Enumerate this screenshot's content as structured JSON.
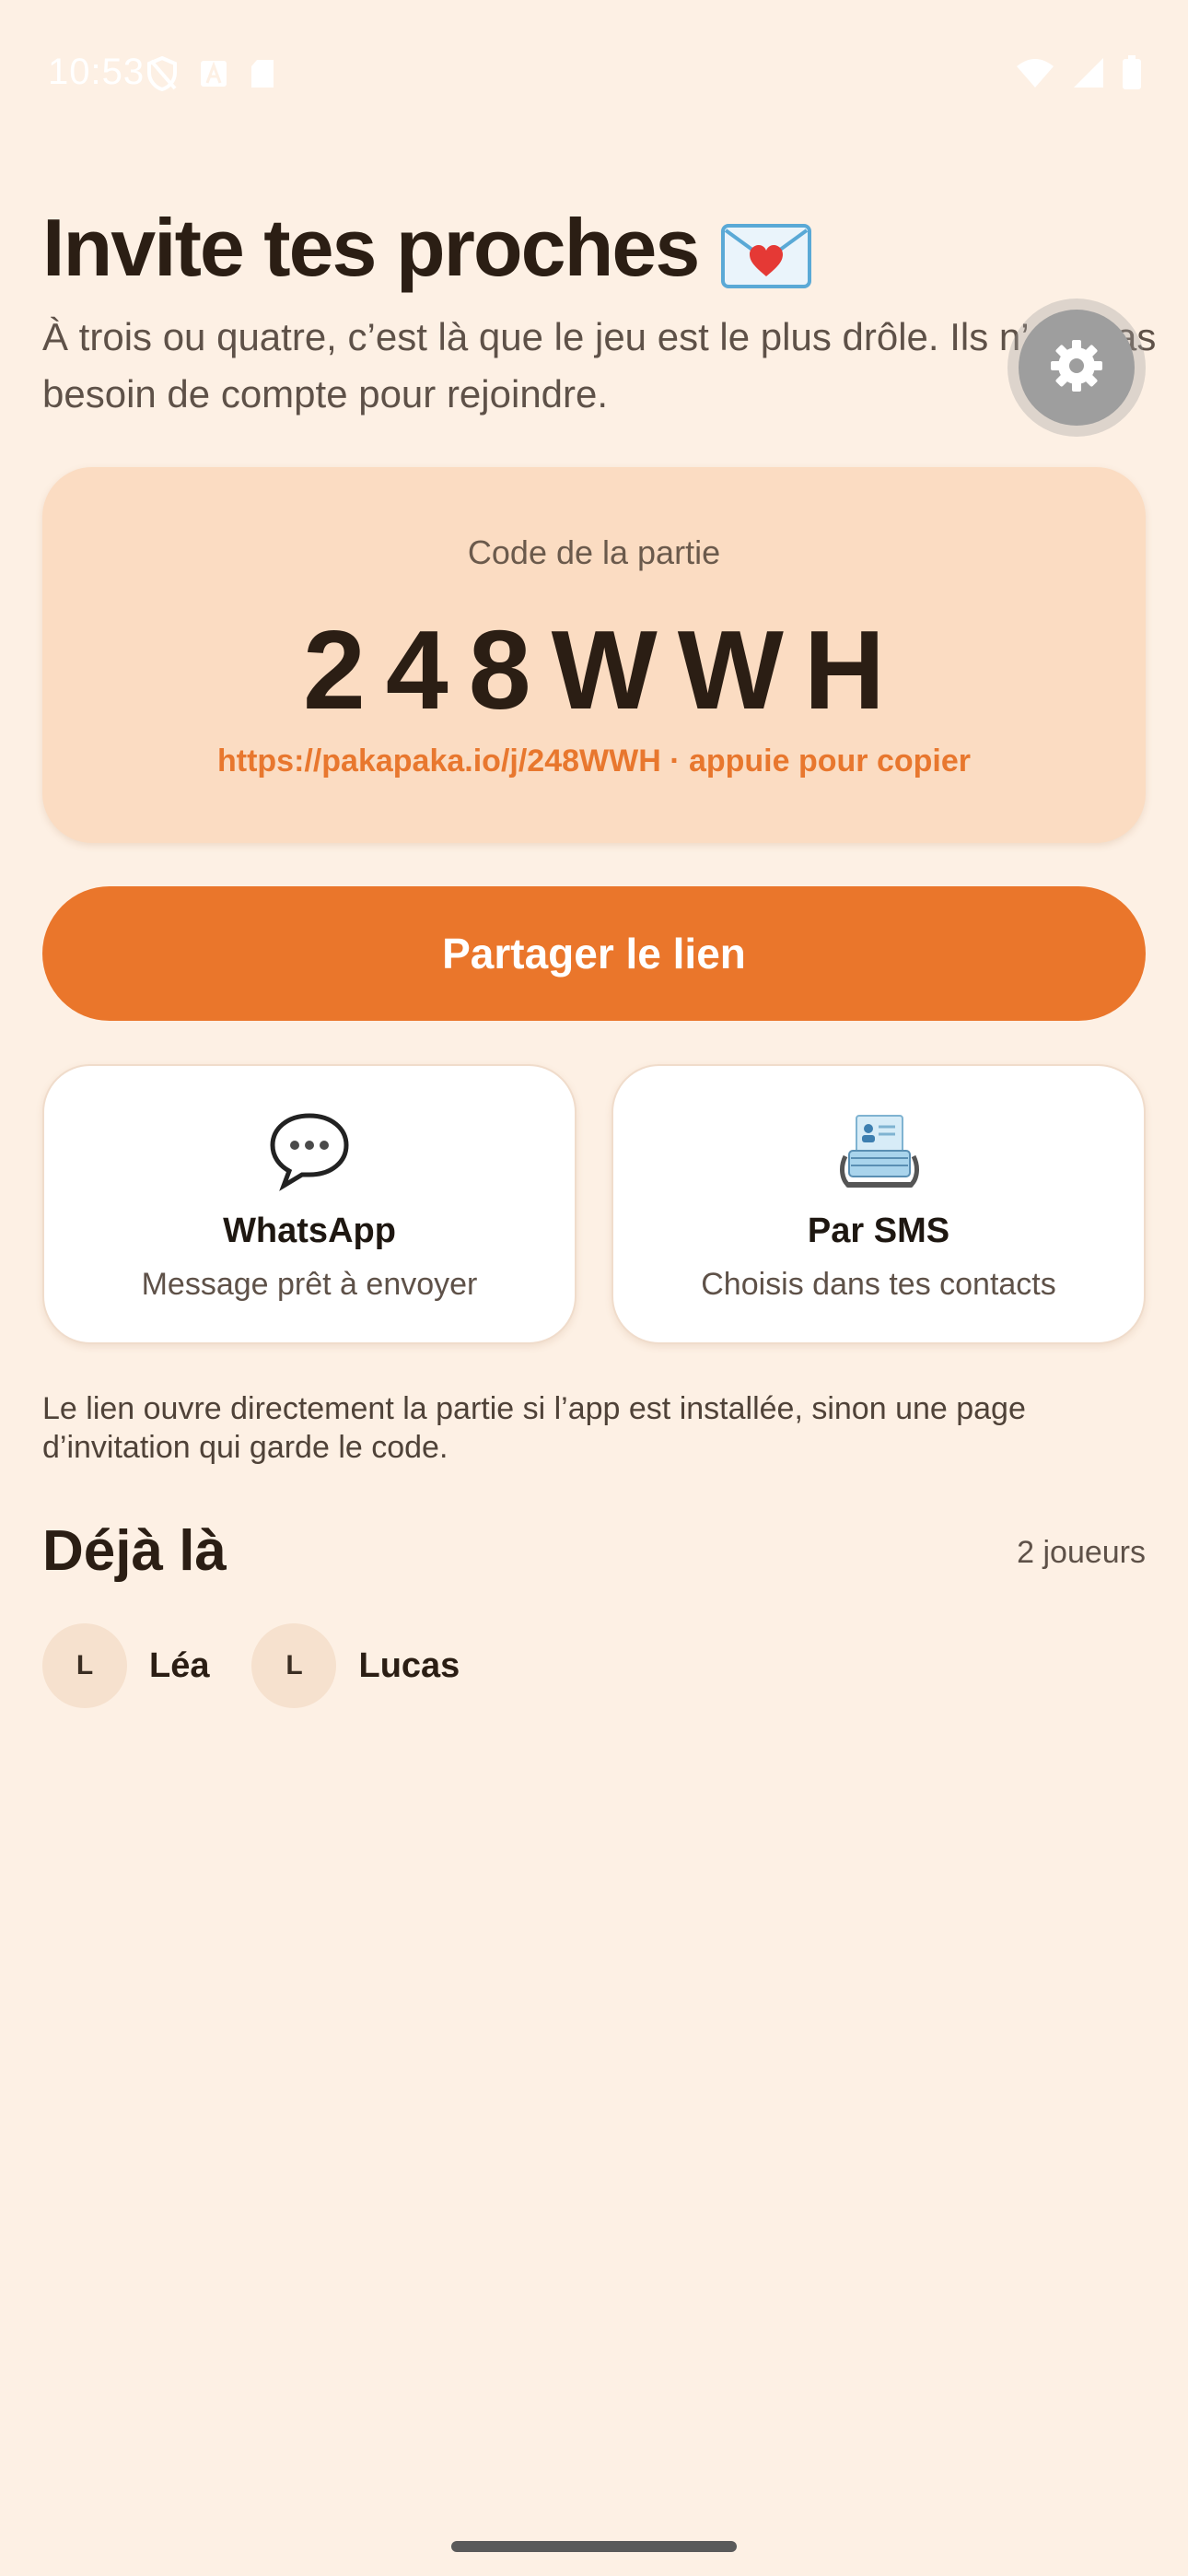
{
  "status_bar": {
    "time": "10:53",
    "icons_left": [
      "shield-off-icon",
      "a-icon",
      "sd-card-icon"
    ],
    "icons_right": [
      "wifi-icon",
      "signal-icon",
      "battery-icon"
    ]
  },
  "header": {
    "title": "Invite tes proches",
    "title_icon": "love-letter-icon",
    "subtitle": "À trois ou quatre, c’est là que le jeu est le plus drôle. Ils n’ont pas besoin de compte pour rejoindre."
  },
  "settings": {
    "icon": "gear-icon"
  },
  "code_card": {
    "label": "Code de la partie",
    "code": "248WWH",
    "link_text": "https://pakapaka.io/j/248WWH · appuie pour copier"
  },
  "share_button": {
    "label": "Partager le lien"
  },
  "options": [
    {
      "icon": "speech-bubble-icon",
      "title": "WhatsApp",
      "subtitle": "Message prêt à envoyer"
    },
    {
      "icon": "rolodex-icon",
      "title": "Par SMS",
      "subtitle": "Choisis dans tes contacts"
    }
  ],
  "info_text": "Le lien ouvre directement la partie si l’app est installée, sinon une page d’invitation qui garde le code.",
  "players_section": {
    "title": "Déjà là",
    "count_label": "2 joueurs",
    "players": [
      {
        "initial": "L",
        "name": "Léa"
      },
      {
        "initial": "L",
        "name": "Lucas"
      }
    ]
  },
  "colors": {
    "background": "#fdf0e4",
    "accent": "#ea762b",
    "card": "#fbdcc2",
    "link": "#e8772e"
  }
}
